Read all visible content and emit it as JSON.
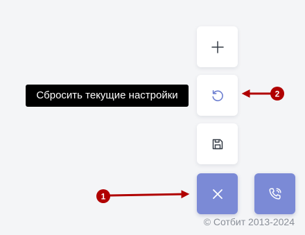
{
  "tooltip": {
    "text": "Сбросить текущие настройки"
  },
  "buttons": {
    "add_icon": "plus-icon",
    "reset_icon": "rotate-ccw-icon",
    "save_icon": "floppy-disk-icon",
    "close_icon": "close-icon",
    "call_icon": "phone-call-icon"
  },
  "annotations": {
    "marker_1": "1",
    "marker_2": "2",
    "color": "#b00000"
  },
  "footer": {
    "copyright": "© Сотбит 2013-2024"
  },
  "colors": {
    "accent": "#7b8ad6",
    "icon": "#333a44",
    "reset_icon": "#6c7ed0",
    "background": "#f4f5f7"
  }
}
